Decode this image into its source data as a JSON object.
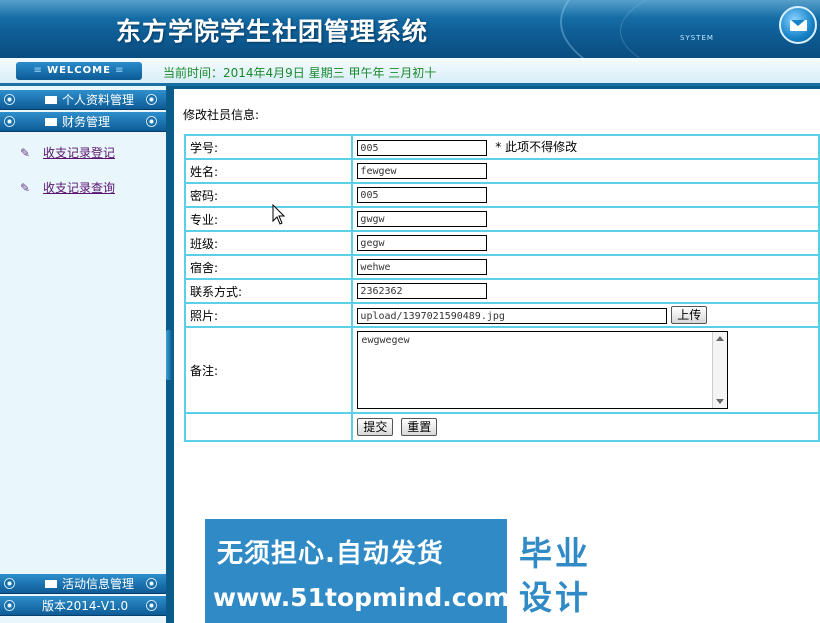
{
  "header": {
    "title": "东方学院学生社团管理系统",
    "system_tag": "SYSTEM",
    "mail_icon": "mail-icon"
  },
  "timebar": {
    "welcome": "WELCOME",
    "time_text": "当前时间：2014年4月9日 星期三 甲午年 三月初十"
  },
  "sidebar": {
    "top_items": [
      {
        "label": "个人资料管理",
        "icon": "mail-icon"
      },
      {
        "label": "财务管理",
        "icon": "mail-icon"
      }
    ],
    "links": [
      {
        "label": "收支记录登记",
        "icon": "pencil-icon"
      },
      {
        "label": "收支记录查询",
        "icon": "pencil-icon"
      }
    ],
    "bottom_items": [
      {
        "label": "活动信息管理",
        "icon": "mail-icon"
      },
      {
        "label": "版本2014-V1.0"
      }
    ]
  },
  "main": {
    "section_title": "修改社员信息:",
    "fields": {
      "student_id": {
        "label": "学号:",
        "value": "005",
        "note": "* 此项不得修改"
      },
      "name": {
        "label": "姓名:",
        "value": "fewgew"
      },
      "password": {
        "label": "密码:",
        "value": "005"
      },
      "major": {
        "label": "专业:",
        "value": "gwgw"
      },
      "class": {
        "label": "班级:",
        "value": "gegw"
      },
      "dorm": {
        "label": "宿舍:",
        "value": "wehwe"
      },
      "contact": {
        "label": "联系方式:",
        "value": "2362362"
      },
      "photo": {
        "label": "照片:",
        "value": "upload/1397021590489.jpg",
        "upload_button": "上传"
      },
      "remark": {
        "label": "备注:",
        "value": "ewgwegew"
      }
    },
    "submit_button": "提交",
    "reset_button": "重置"
  },
  "banner": {
    "line1": "无须担心.自动发货",
    "line2": "www.51topmind.com",
    "box_line1": "毕业",
    "box_line2": "设计"
  },
  "colors": {
    "header_blue": "#0f5e96",
    "table_border": "#5ad0e8",
    "time_green": "#1a8a2a",
    "link_purple": "#5a1470",
    "banner_blue": "#2f8ac6"
  }
}
